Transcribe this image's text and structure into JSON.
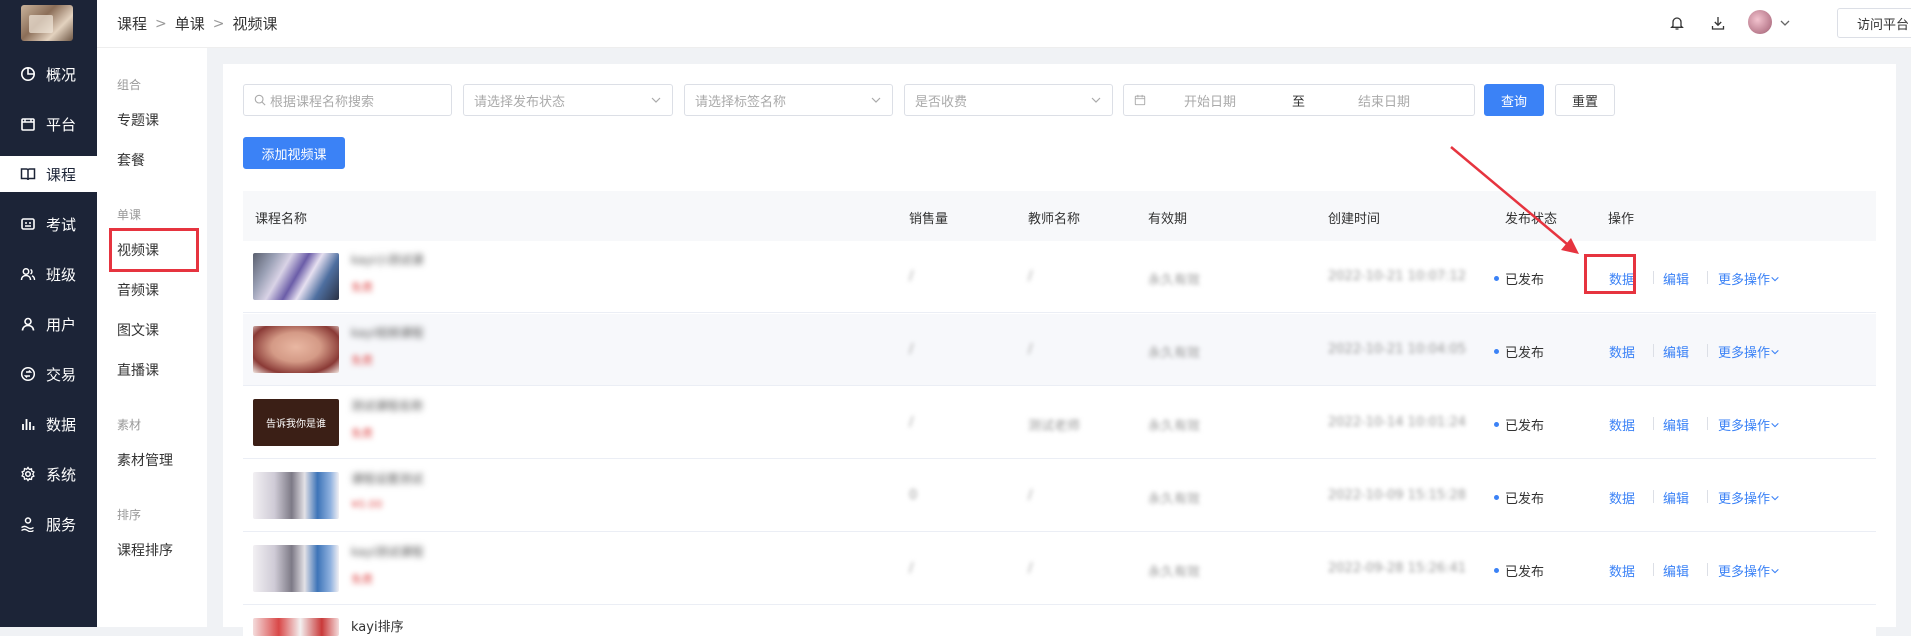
{
  "nav": {
    "items": [
      {
        "label": "概况",
        "icon": "dashboard-icon"
      },
      {
        "label": "平台",
        "icon": "store-icon"
      },
      {
        "label": "课程",
        "icon": "book-icon"
      },
      {
        "label": "考试",
        "icon": "exam-icon"
      },
      {
        "label": "班级",
        "icon": "users-icon"
      },
      {
        "label": "用户",
        "icon": "user-icon"
      },
      {
        "label": "交易",
        "icon": "trade-icon"
      },
      {
        "label": "数据",
        "icon": "bar-chart-icon"
      },
      {
        "label": "系统",
        "icon": "gear-icon"
      },
      {
        "label": "服务",
        "icon": "service-icon"
      }
    ],
    "active_index": 2
  },
  "header": {
    "breadcrumb": [
      "课程",
      "单课",
      "视频课"
    ],
    "visit_label": "访问平台"
  },
  "subnav": {
    "group_combo": "组合",
    "item_topic": "专题课",
    "item_package": "套餐",
    "group_single": "单课",
    "item_video": "视频课",
    "item_audio": "音频课",
    "item_article": "图文课",
    "item_live": "直播课",
    "group_material": "素材",
    "item_material": "素材管理",
    "group_sort": "排序",
    "item_sort": "课程排序"
  },
  "filters": {
    "search_placeholder": "根据课程名称搜索",
    "status_placeholder": "请选择发布状态",
    "tag_placeholder": "请选择标签名称",
    "charge_placeholder": "是否收费",
    "start_placeholder": "开始日期",
    "range_sep": "至",
    "end_placeholder": "结束日期",
    "query_label": "查询",
    "reset_label": "重置",
    "add_label": "添加视频课"
  },
  "table": {
    "columns": [
      "课程名称",
      "销售量",
      "教师名称",
      "有效期",
      "创建时间",
      "发布状态",
      "操作"
    ],
    "rows": [
      {
        "title": "kayi小测试课",
        "price": "免费",
        "sales": "/",
        "teacher": "/",
        "validity": "永久有效",
        "created": "2022-10-21 10:07:12",
        "status": "已发布"
      },
      {
        "title": "kayi视频课程",
        "price": "免费",
        "sales": "/",
        "teacher": "/",
        "validity": "永久有效",
        "created": "2022-10-21 10:04:05",
        "status": "已发布"
      },
      {
        "title": "测试课程名称",
        "price": "免费",
        "sales": "/",
        "teacher": "测试老师",
        "validity": "永久有效",
        "created": "2022-10-14 10:01:24",
        "status": "已发布"
      },
      {
        "title": "课程设置测试",
        "price": "¥0.00",
        "sales": "0",
        "teacher": "/",
        "validity": "永久有效",
        "created": "2022-10-09 15:15:28",
        "status": "已发布"
      },
      {
        "title": "kayi测试课程",
        "price": "免费",
        "sales": "/",
        "teacher": "/",
        "validity": "永久有效",
        "created": "2022-09-28 15:26:41",
        "status": "已发布"
      },
      {
        "title": "kayi排序",
        "price": "",
        "sales": "",
        "teacher": "",
        "validity": "",
        "created": "",
        "status": ""
      }
    ],
    "thumb3_text": "告诉我你是谁",
    "op_data": "数据",
    "op_edit": "编辑",
    "op_more": "更多操作"
  }
}
